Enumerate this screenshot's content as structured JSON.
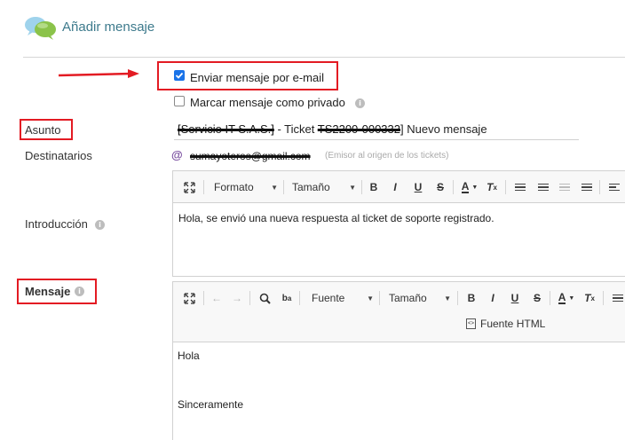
{
  "header": {
    "title": "Añadir mensaje",
    "icon": "speech-bubbles-icon"
  },
  "options": {
    "send_email": {
      "label": "Enviar mensaje por e-mail",
      "checked": true
    },
    "private": {
      "label": "Marcar mensaje como privado",
      "checked": false
    }
  },
  "fields": {
    "subject": {
      "label": "Asunto",
      "value_redacted": "[Servicio IT S.A.S.]",
      "value_mid": " - Ticket ",
      "value_ticket_redacted": "TS2200-000332",
      "value_end": "] Nuevo mensaje"
    },
    "recipients": {
      "label": "Destinatarios",
      "email_redacted": "sumayoteros@gmail.com",
      "note": "(Emisor al origen de los tickets)"
    },
    "intro": {
      "label": "Introducción",
      "toolbar": {
        "format": "Formato",
        "size": "Tamaño"
      },
      "body": "Hola, se envió una nueva respuesta al ticket de soporte registrado."
    },
    "message": {
      "label": "Mensaje",
      "toolbar": {
        "font": "Fuente",
        "size": "Tamaño",
        "html": "Fuente HTML"
      },
      "body_line1": "Hola",
      "body_line2": "Sinceramente"
    }
  },
  "annotations": {
    "arrow_color": "#e31b23",
    "box_color": "#e31b23"
  }
}
